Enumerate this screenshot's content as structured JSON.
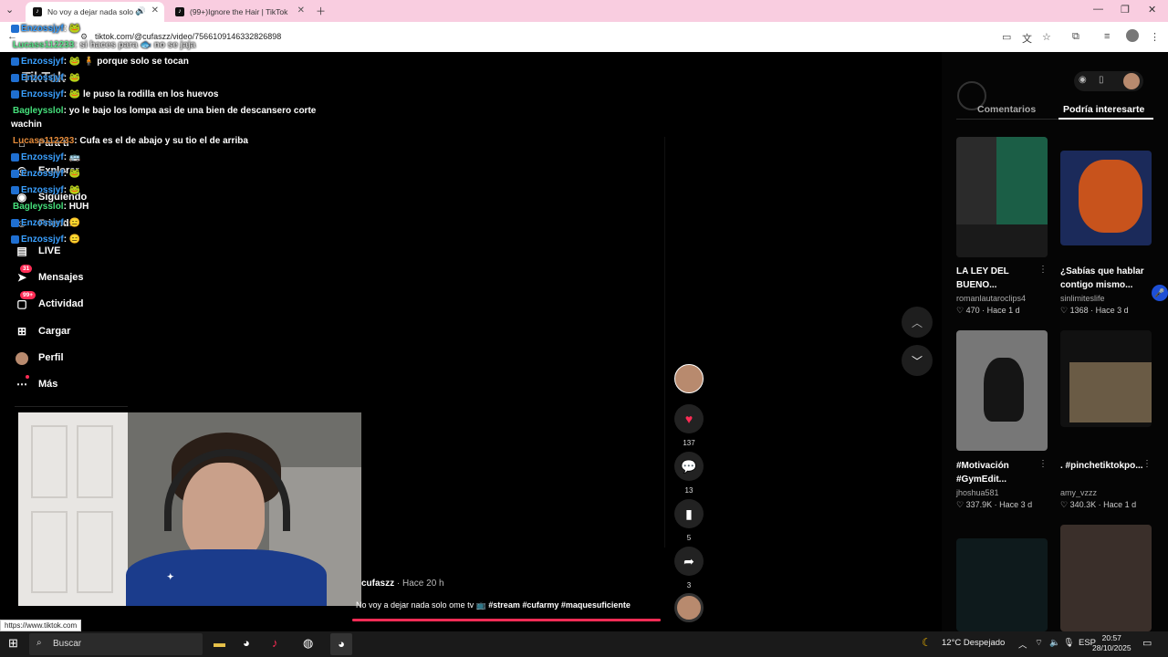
{
  "browser": {
    "tabs": [
      {
        "label": "No voy a dejar nada solo o"
      },
      {
        "label": "(99+)Ignore the Hair | TikTok"
      }
    ],
    "url": "tiktok.com/@cufaszz/video/7566109146332826898",
    "status_url": "https://www.tiktok.com"
  },
  "nav": {
    "logo": "TikTok",
    "items": [
      {
        "label": "Para ti",
        "icon": "home-icon"
      },
      {
        "label": "Explorar",
        "icon": "compass-icon"
      },
      {
        "label": "Siguiendo",
        "icon": "following-icon"
      },
      {
        "label": "Friends",
        "icon": "friends-icon"
      },
      {
        "label": "LIVE",
        "icon": "live-icon"
      },
      {
        "label": "Mensajes",
        "icon": "message-icon",
        "badge": "31"
      },
      {
        "label": "Actividad",
        "icon": "activity-icon",
        "badge": "99+"
      },
      {
        "label": "Cargar",
        "icon": "upload-icon"
      },
      {
        "label": "Perfil",
        "icon": "profile-icon"
      },
      {
        "label": "Más",
        "icon": "more-icon"
      }
    ]
  },
  "chat": [
    {
      "user": "Enzossjyf",
      "text": ": 🐸"
    },
    {
      "user": "Lucass112233",
      "text": ": si haces para 🐟 no se jaja"
    },
    {
      "user": "Enzossjyf",
      "text": ": 🐸 🧍 porque solo se tocan"
    },
    {
      "user": "Enzossjyf",
      "text": ": 🐸"
    },
    {
      "user": "Enzossjyf",
      "text": ": 🐸 le puso la rodilla en los huevos"
    },
    {
      "user": "Bagleysslol",
      "text": ": yo le bajo los lompa asi de una bien de descansero corte"
    },
    {
      "user": "",
      "text": "wachin"
    },
    {
      "user": "Lucass112233",
      "text": ": Cufa es el de abajo y su tio el de arriba"
    },
    {
      "user": "Enzossjyf",
      "text": ": 🚌"
    },
    {
      "user": "Enzossjyf",
      "text": ": 🐸"
    },
    {
      "user": "Enzossjyf",
      "text": ": 🐸"
    },
    {
      "user": "Bagleysslol",
      "text": ": HUH"
    },
    {
      "user": "Enzossjyf",
      "text": ": 😑"
    },
    {
      "user": "Enzossjyf",
      "text": ": 😑"
    }
  ],
  "video": {
    "author": "cufaszz",
    "time": " · Hace 20 h",
    "caption": "No voy a dejar nada solo ome tv 📺",
    "tags": "#stream #cufarmy #maquesuficiente",
    "progress": 1.0
  },
  "actions": {
    "likes": "137",
    "comments": "13",
    "saves": "5",
    "shares": "3"
  },
  "right_panel": {
    "tabs": [
      "Comentarios",
      "Podría interesarte"
    ],
    "cards": [
      {
        "title": "LA LEY DEL BUENO...",
        "author": "romanlautaroclips4",
        "likes": "470",
        "time": "Hace 1 d"
      },
      {
        "title": "¿Sabías que hablar contigo mismo...",
        "author": "sinlimiteslife",
        "likes": "1368",
        "time": "Hace 3 d"
      },
      {
        "title": "#Motivación #GymEdit...",
        "author": "jhoshua581",
        "likes": "337.9K",
        "time": "Hace 3 d"
      },
      {
        "title": ". #pinchetiktokpo...",
        "author": "amy_vzzz",
        "likes": "340.3K",
        "time": "Hace 1 d"
      }
    ]
  },
  "taskbar": {
    "search": "Buscar",
    "weather": "12°C  Despejado",
    "lang": "ESP",
    "time": "20:57",
    "date": "28/10/2025"
  }
}
